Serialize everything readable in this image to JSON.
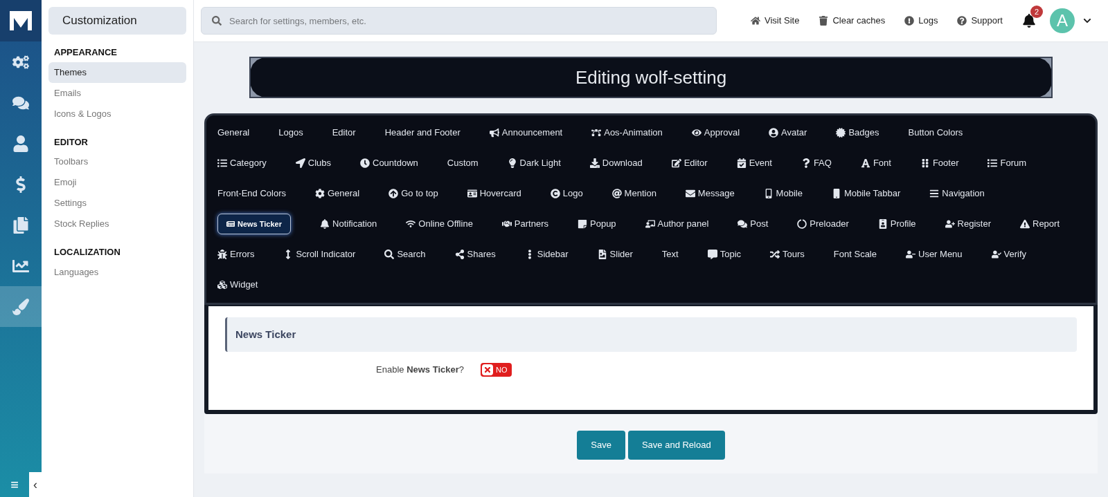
{
  "rail": {
    "items": [
      {
        "selected": false
      },
      {
        "selected": false
      },
      {
        "selected": false
      },
      {
        "selected": false
      },
      {
        "selected": false
      },
      {
        "selected": false
      },
      {
        "selected": true
      }
    ],
    "menu_glyph": "≡",
    "collapse_glyph": "‹"
  },
  "sidebar": {
    "title": "Customization",
    "sections": [
      {
        "heading": "APPEARANCE",
        "items": [
          {
            "label": "Themes",
            "selected": true
          },
          {
            "label": "Emails",
            "selected": false
          },
          {
            "label": "Icons & Logos",
            "selected": false
          }
        ]
      },
      {
        "heading": "EDITOR",
        "items": [
          {
            "label": "Toolbars",
            "selected": false
          },
          {
            "label": "Emoji",
            "selected": false
          },
          {
            "label": "Settings",
            "selected": false
          },
          {
            "label": "Stock Replies",
            "selected": false
          }
        ]
      },
      {
        "heading": "LOCALIZATION",
        "items": [
          {
            "label": "Languages",
            "selected": false
          }
        ]
      }
    ]
  },
  "search": {
    "placeholder": "Search for settings, members, etc."
  },
  "top_links": [
    "Visit Site",
    "Clear caches",
    "Logs",
    "Support"
  ],
  "notifications": {
    "count": "2"
  },
  "avatar": {
    "letter": "A"
  },
  "banner": {
    "title": "Editing wolf-setting"
  },
  "tab_rows": [
    [
      {
        "label": "General",
        "kind": "plain",
        "selected": false
      },
      {
        "label": "Logos",
        "kind": "plain",
        "selected": false
      },
      {
        "label": "Editor",
        "kind": "plain",
        "selected": false
      },
      {
        "label": "Header and Footer",
        "kind": "plain",
        "selected": false
      },
      {
        "label": "Announcement",
        "kind": "icon",
        "selected": false
      },
      {
        "label": "Aos-Animation",
        "kind": "icon",
        "selected": false
      },
      {
        "label": "Approval",
        "kind": "icon",
        "selected": false
      },
      {
        "label": "Avatar",
        "kind": "icon",
        "selected": false
      },
      {
        "label": "Badges",
        "kind": "icon",
        "selected": false
      },
      {
        "label": "Button Colors",
        "kind": "plain",
        "selected": false
      }
    ],
    [
      {
        "label": "Category",
        "kind": "icon",
        "selected": false
      },
      {
        "label": "Clubs",
        "kind": "icon",
        "selected": false
      },
      {
        "label": "Countdown",
        "kind": "icon",
        "selected": false
      },
      {
        "label": "Custom",
        "kind": "plain",
        "selected": false
      },
      {
        "label": "Dark Light",
        "kind": "icon",
        "selected": false
      },
      {
        "label": "Download",
        "kind": "icon",
        "selected": false
      },
      {
        "label": "Editor",
        "kind": "icon",
        "selected": false
      },
      {
        "label": "Event",
        "kind": "icon",
        "selected": false
      },
      {
        "label": "FAQ",
        "kind": "icon",
        "selected": false
      },
      {
        "label": "Font",
        "kind": "icon",
        "selected": false
      },
      {
        "label": "Footer",
        "kind": "icon",
        "selected": false
      },
      {
        "label": "Forum",
        "kind": "icon",
        "selected": false
      }
    ],
    [
      {
        "label": "Front-End Colors",
        "kind": "plain",
        "selected": false
      },
      {
        "label": "General",
        "kind": "icon",
        "selected": false
      },
      {
        "label": "Go to top",
        "kind": "icon",
        "selected": false
      },
      {
        "label": "Hovercard",
        "kind": "icon",
        "selected": false
      },
      {
        "label": "Logo",
        "kind": "icon",
        "selected": false
      },
      {
        "label": "Mention",
        "kind": "icon",
        "selected": false
      },
      {
        "label": "Message",
        "kind": "icon",
        "selected": false
      },
      {
        "label": "Mobile",
        "kind": "icon",
        "selected": false
      },
      {
        "label": "Mobile Tabbar",
        "kind": "icon",
        "selected": false
      },
      {
        "label": "Navigation",
        "kind": "icon",
        "selected": false
      }
    ],
    [
      {
        "label": "News Ticker",
        "kind": "icon",
        "selected": true
      },
      {
        "label": "Notification",
        "kind": "icon",
        "selected": false
      },
      {
        "label": "Online Offline",
        "kind": "icon",
        "selected": false
      },
      {
        "label": "Partners",
        "kind": "icon",
        "selected": false
      },
      {
        "label": "Popup",
        "kind": "icon",
        "selected": false
      },
      {
        "label": "Author panel",
        "kind": "icon",
        "selected": false
      },
      {
        "label": "Post",
        "kind": "icon",
        "selected": false
      },
      {
        "label": "Preloader",
        "kind": "icon",
        "selected": false
      },
      {
        "label": "Profile",
        "kind": "icon",
        "selected": false
      },
      {
        "label": "Register",
        "kind": "icon",
        "selected": false
      },
      {
        "label": "Report",
        "kind": "icon",
        "selected": false
      }
    ],
    [
      {
        "label": "Errors",
        "kind": "icon",
        "selected": false
      },
      {
        "label": "Scroll Indicator",
        "kind": "icon",
        "selected": false
      },
      {
        "label": "Search",
        "kind": "icon",
        "selected": false
      },
      {
        "label": "Shares",
        "kind": "icon",
        "selected": false
      },
      {
        "label": "Sidebar",
        "kind": "icon",
        "selected": false
      },
      {
        "label": "Slider",
        "kind": "icon",
        "selected": false
      },
      {
        "label": "Text",
        "kind": "plain",
        "selected": false
      },
      {
        "label": "Topic",
        "kind": "icon",
        "selected": false
      },
      {
        "label": "Tours",
        "kind": "icon",
        "selected": false
      },
      {
        "label": "Font Scale",
        "kind": "plain",
        "selected": false
      },
      {
        "label": "User Menu",
        "kind": "icon",
        "selected": false
      },
      {
        "label": "Verify",
        "kind": "icon",
        "selected": false
      }
    ],
    [
      {
        "label": "Widget",
        "kind": "icon",
        "selected": false
      }
    ]
  ],
  "form": {
    "section_title": "News Ticker",
    "rows": [
      {
        "label": "Enable **News Ticker**?",
        "on": false,
        "toggle_label": "NO"
      }
    ]
  },
  "buttons": [
    "Save",
    "Save and Reload"
  ]
}
